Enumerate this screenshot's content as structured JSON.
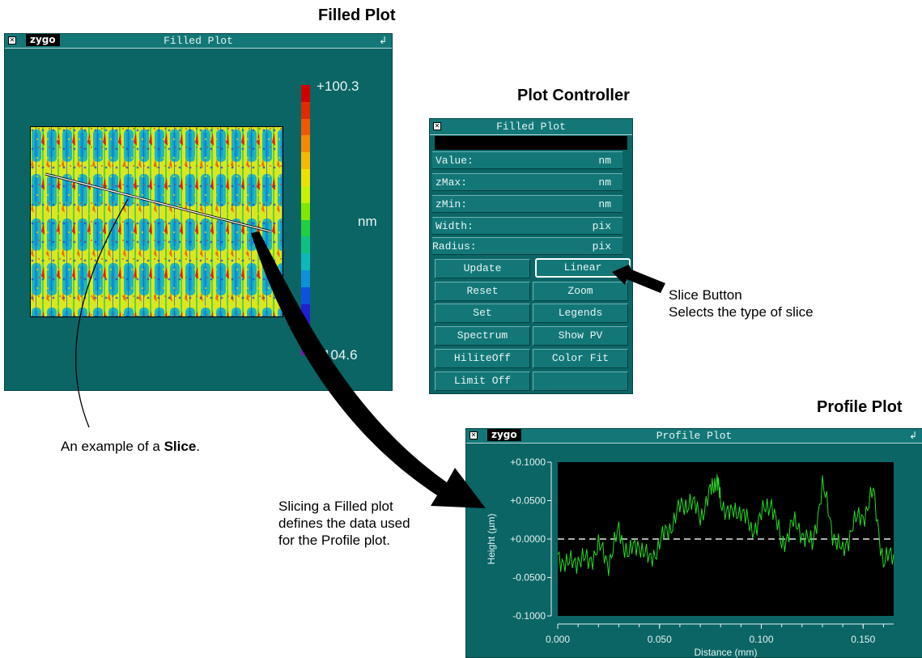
{
  "headings": {
    "filled_plot": "Filled Plot",
    "plot_controller": "Plot Controller",
    "profile_plot": "Profile Plot"
  },
  "filled_window": {
    "logo": "zygo",
    "title": "Filled Plot",
    "scale_max": "+100.3",
    "scale_min": "104.6",
    "unit": "nm"
  },
  "controller_window": {
    "title": "Filled Plot",
    "fields": [
      {
        "label": "Value:",
        "unit": "nm"
      },
      {
        "label": "zMax:",
        "unit": "nm"
      },
      {
        "label": "zMin:",
        "unit": "nm"
      },
      {
        "label": "Width:",
        "unit": "pix"
      },
      {
        "label": "Radius:",
        "unit": "pix"
      }
    ],
    "buttons": [
      [
        "Update",
        "Linear"
      ],
      [
        "Reset",
        "Zoom"
      ],
      [
        "Set",
        "Legends"
      ],
      [
        "Spectrum",
        "Show PV"
      ],
      [
        "HiliteOff",
        "Color Fit"
      ],
      [
        "Limit Off",
        ""
      ]
    ],
    "selected_button": "Linear"
  },
  "profile_window": {
    "logo": "zygo",
    "title": "Profile Plot"
  },
  "annotations": {
    "slice_button_line1": "Slice Button",
    "slice_button_line2": "Selects the type of slice",
    "slice_example_prefix": "An example of a ",
    "slice_example_bold": "Slice",
    "slice_example_suffix": ".",
    "slicing_line1": "Slicing a Filled plot",
    "slicing_line2": "defines the data used",
    "slicing_line3": "for the Profile plot."
  },
  "colors": {
    "window_bg": "#0b6565",
    "scale": [
      "#d10000",
      "#e02a00",
      "#f05800",
      "#f88800",
      "#f8b800",
      "#f0e000",
      "#c8f000",
      "#80e800",
      "#20d040",
      "#10c080",
      "#10b8b8",
      "#1090d8",
      "#1050e0",
      "#2020d0",
      "#5010c0",
      "#8010b8"
    ]
  },
  "chart_data": {
    "type": "line",
    "title": "",
    "xlabel": "Distance (mm)",
    "ylabel": "Height (µm)",
    "xlim": [
      0.0,
      0.165
    ],
    "ylim": [
      -0.1,
      0.1
    ],
    "x_ticks": [
      "0.000",
      "0.050",
      "0.100",
      "0.150"
    ],
    "y_ticks": [
      "+0.1000",
      "+0.0500",
      "+0.0000",
      "-0.0500",
      "-0.1000"
    ],
    "reference_line": 0.0,
    "series": [
      {
        "color": "#22dd22",
        "x": [
          0.0,
          0.005,
          0.01,
          0.015,
          0.02,
          0.025,
          0.03,
          0.035,
          0.04,
          0.045,
          0.05,
          0.055,
          0.06,
          0.065,
          0.07,
          0.075,
          0.078,
          0.08,
          0.085,
          0.09,
          0.095,
          0.1,
          0.105,
          0.11,
          0.115,
          0.12,
          0.125,
          0.13,
          0.135,
          0.14,
          0.145,
          0.15,
          0.155,
          0.16,
          0.165
        ],
        "y": [
          -0.02,
          -0.035,
          -0.025,
          -0.03,
          -0.01,
          -0.03,
          0.01,
          -0.02,
          -0.005,
          -0.03,
          -0.005,
          0.015,
          0.04,
          0.05,
          0.03,
          0.06,
          0.08,
          0.05,
          0.03,
          0.04,
          0.01,
          0.03,
          0.05,
          -0.01,
          0.02,
          0.01,
          -0.01,
          0.07,
          0.01,
          -0.02,
          0.02,
          0.03,
          0.06,
          -0.03,
          -0.02
        ]
      }
    ]
  }
}
